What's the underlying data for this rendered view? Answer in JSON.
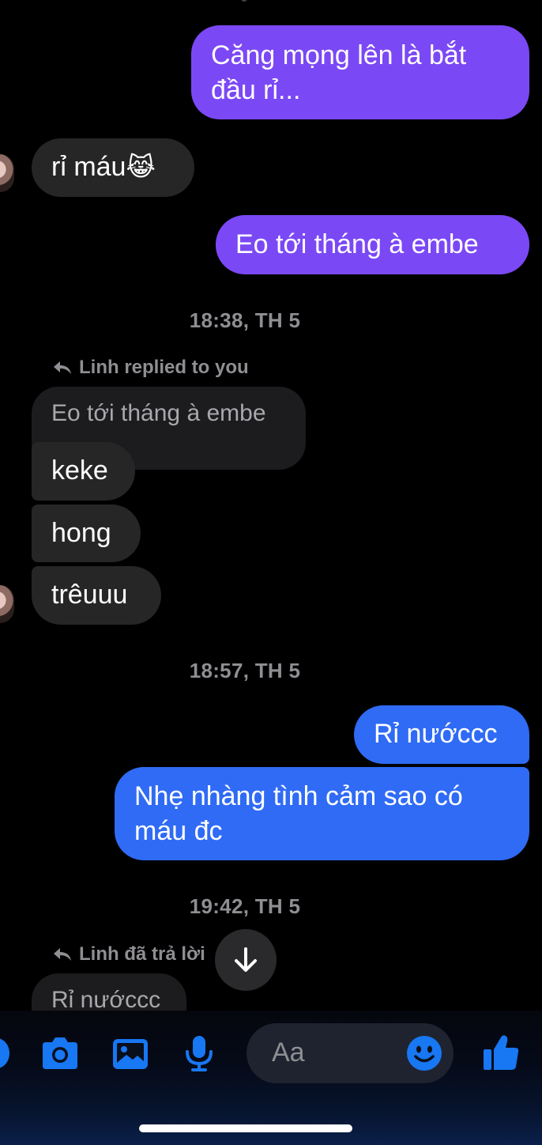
{
  "messages": {
    "m1": "Căng mọng lên là bắt đầu rỉ...",
    "m1_line1": "Căng mọng lên là bắt",
    "m1_line2": "đầu rỉ...",
    "m2_text": "rỉ máu",
    "m2_emoji": "😹",
    "m3": "Eo tới tháng à embe",
    "m4": "keke",
    "m5": "hong",
    "m6": "trêuuu",
    "m7": "Rỉ nướccc",
    "m8_line1": "Nhẹ nhàng tình cảm sao có",
    "m8_line2": "máu đc",
    "m9": "Rỉ nướccc"
  },
  "timestamps": {
    "t1": "18:38, TH 5",
    "t2": "18:57, TH 5",
    "t3": "19:42, TH 5"
  },
  "replies": {
    "r1_header": "Linh replied to you",
    "r1_quote": "Eo tới tháng à embe",
    "r2_header": "Linh đã trả lời"
  },
  "composer": {
    "placeholder": "Aa"
  },
  "colors": {
    "incoming": "#262626",
    "outgoing_purple": "#7b48f5",
    "outgoing_blue": "#2f6bf5",
    "icon_blue": "#1877f2"
  },
  "icons": [
    "reply-arrow-icon",
    "arrow-down-icon",
    "camera-icon",
    "gallery-icon",
    "microphone-icon",
    "emoji-icon",
    "thumbs-up-icon",
    "more-icon"
  ]
}
